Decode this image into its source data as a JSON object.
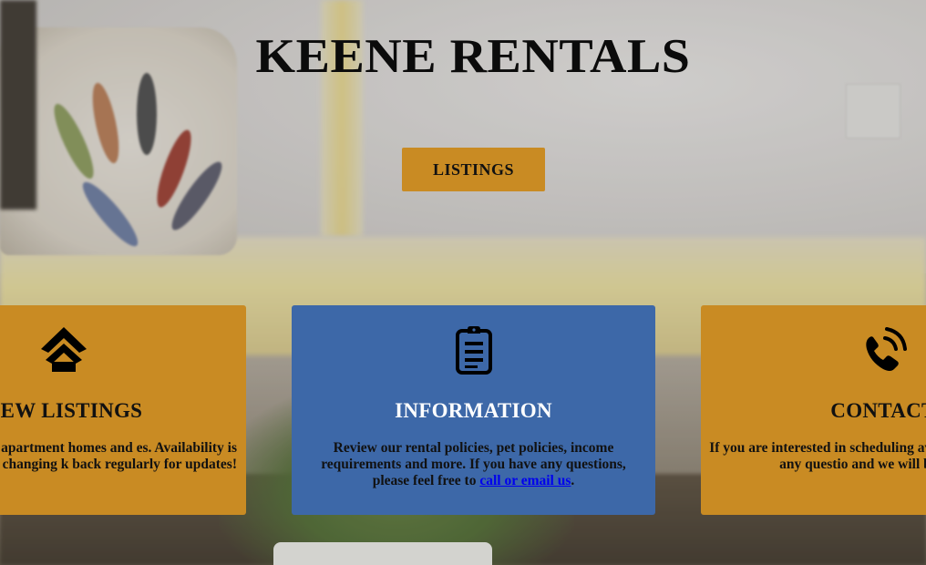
{
  "site": {
    "title": "KEENE RENTALS",
    "listings_button": "LISTINGS"
  },
  "cards": [
    {
      "icon": "home-icon",
      "heading": "NEW LISTINGS",
      "text": "tion of available apartment homes and es. Availability is constantly changing k back regularly for updates!",
      "color": "#c98b23"
    },
    {
      "icon": "clipboard-icon",
      "heading": "INFORMATION",
      "text_before": "Review our rental policies, pet policies, income requirements and more. If you have any questions, please feel free to ",
      "link": "call or email us",
      "text_after": ".",
      "color": "#3d68a8"
    },
    {
      "icon": "phone-icon",
      "heading": "CONTACT",
      "text": "If you are interested in scheduling available units, or have any questio and we will be happy t",
      "color": "#c98b23"
    }
  ]
}
